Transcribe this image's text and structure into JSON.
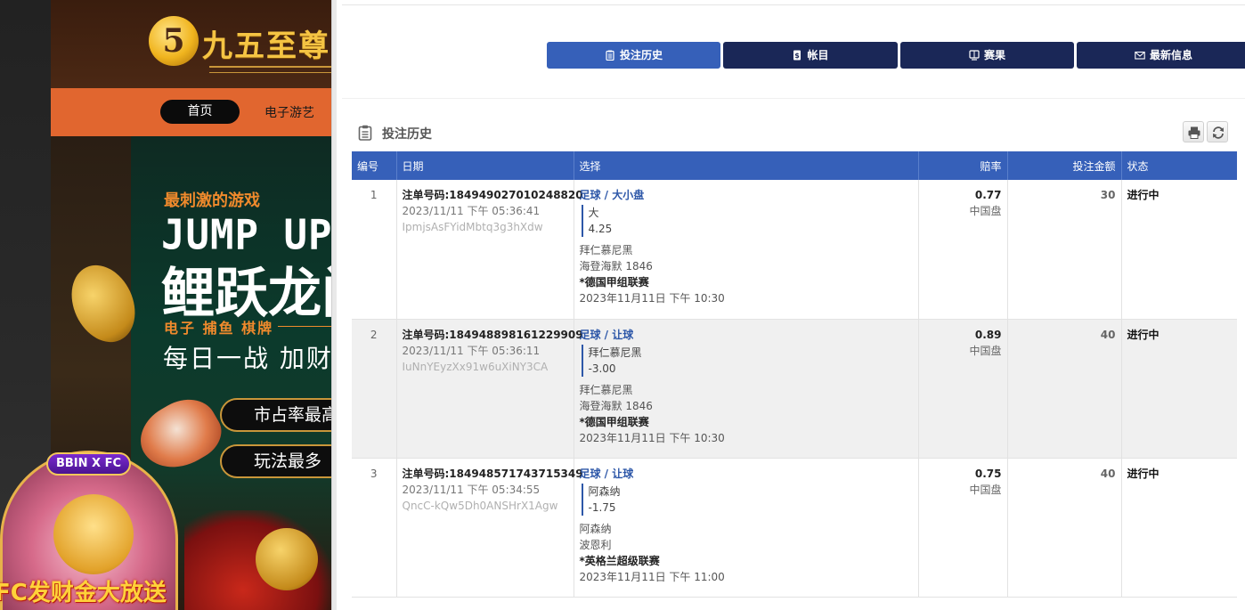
{
  "background_site": {
    "logo_glyph": "5",
    "logo_text": "九五至尊",
    "nav": {
      "home": "首页",
      "games": "电子游艺"
    },
    "banner": {
      "tagline": "最刺激的游戏",
      "title_en": "JUMP UP",
      "title_cn": "鲤跃龙门",
      "categories": "电子 捕鱼 棋牌",
      "daily": "每日一战 加财",
      "pill_1": "市占率最高",
      "pill_2": "玩法最多",
      "badge": "BBIN X FC",
      "bottom": "FC发财金大放送"
    }
  },
  "tabs": [
    {
      "label": "投注历史",
      "icon": "clipboard-icon",
      "active": true
    },
    {
      "label": "帐目",
      "icon": "ledger-icon",
      "active": false
    },
    {
      "label": "赛果",
      "icon": "scoreboard-icon",
      "active": false
    },
    {
      "label": "最新信息",
      "icon": "envelope-icon",
      "active": false
    }
  ],
  "section": {
    "title": "投注历史"
  },
  "table": {
    "headers": [
      "编号",
      "日期",
      "选择",
      "赔率",
      "投注金额",
      "状态"
    ],
    "rows": [
      {
        "no": "1",
        "ticket": "注单号码:184949027010248820",
        "datetime": "2023/11/11 下午 05:36:41",
        "code": "IpmjsAsFYidMbtq3g3hXdw",
        "market": "足球 / 大小盘",
        "pick": "大",
        "pick_line": "4.25",
        "home": "拜仁慕尼黑",
        "away": "海登海默 1846",
        "league": "*德国甲组联赛",
        "match_time": "2023年11月11日 下午 10:30",
        "odds": "0.77",
        "odds_type": "中国盘",
        "amount": "30",
        "status": "进行中"
      },
      {
        "no": "2",
        "ticket": "注单号码:184948898161229909",
        "datetime": "2023/11/11 下午 05:36:11",
        "code": "IuNnYEyzXx91w6uXiNY3CA",
        "market": "足球 / 让球",
        "pick": "拜仁慕尼黑",
        "pick_line": "-3.00",
        "home": "拜仁慕尼黑",
        "away": "海登海默 1846",
        "league": "*德国甲组联赛",
        "match_time": "2023年11月11日 下午 10:30",
        "odds": "0.89",
        "odds_type": "中国盘",
        "amount": "40",
        "status": "进行中"
      },
      {
        "no": "3",
        "ticket": "注单号码:184948571743715349",
        "datetime": "2023/11/11 下午 05:34:55",
        "code": "QncC-kQw5Dh0ANSHrX1Agw",
        "market": "足球 / 让球",
        "pick": "阿森纳",
        "pick_line": "-1.75",
        "home": "阿森纳",
        "away": "波恩利",
        "league": "*英格兰超级联赛",
        "match_time": "2023年11月11日 下午 11:00",
        "odds": "0.75",
        "odds_type": "中国盘",
        "amount": "40",
        "status": "进行中"
      }
    ]
  },
  "colors": {
    "tab_active": "#3660b9",
    "tab_inactive": "#1a2757",
    "header_bg": "#3660b9",
    "link_blue": "#2d57a8"
  }
}
